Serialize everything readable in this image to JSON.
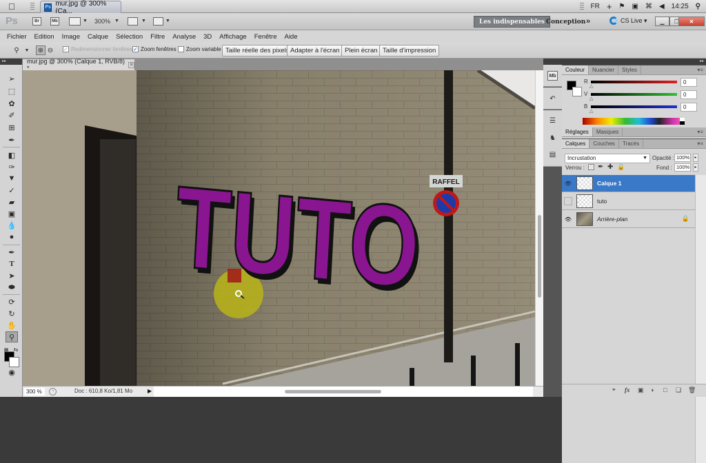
{
  "os_bar": {
    "app_tab": "mur.jpg @ 300% (Ca...",
    "app_badge": "Ps",
    "language": "FR",
    "time": "14:25"
  },
  "app_bar": {
    "logo": "Ps",
    "bridge_label": "Br",
    "minibridge_label": "Mb",
    "zoom_level": "300%",
    "workspaces": [
      "Les indispensables",
      "Conception"
    ],
    "more": "»",
    "cs_live": "CS Live ▾"
  },
  "menu": [
    "Fichier",
    "Edition",
    "Image",
    "Calque",
    "Sélection",
    "Filtre",
    "Analyse",
    "3D",
    "Affichage",
    "Fenêtre",
    "Aide"
  ],
  "options_bar": {
    "resize_windows": {
      "label": "Redimensionner fenêtres",
      "checked": true,
      "enabled": false
    },
    "zoom_windows": {
      "label": "Zoom fenêtres",
      "checked": true
    },
    "scrubby_zoom": {
      "label": "Zoom variable",
      "checked": false
    },
    "buttons": [
      "Taille réelle des pixels",
      "Adapter à l'écran",
      "Plein écran",
      "Taille d'impression"
    ]
  },
  "document": {
    "tab_title": "mur.jpg @ 300% (Calque 1, RVB/8) *",
    "sign_text": "RAFFEL",
    "graffiti_text": "TUTO"
  },
  "status_bar": {
    "zoom": "300 %",
    "doc_info": "Doc : 610,8 Ko/1,81 Mo"
  },
  "color_panel": {
    "tabs": [
      "Couleur",
      "Nuancier",
      "Styles"
    ],
    "active_tab": "Couleur",
    "foreground": "#000000",
    "background": "#ffffff",
    "channels": [
      {
        "label": "R",
        "value": "0",
        "color": "#e02020"
      },
      {
        "label": "V",
        "value": "0",
        "color": "#30c030"
      },
      {
        "label": "B",
        "value": "0",
        "color": "#2030d0"
      }
    ]
  },
  "adjust_panel": {
    "tabs": [
      "Réglages",
      "Masques"
    ],
    "active_tab": "Réglages"
  },
  "layers_panel": {
    "tabs": [
      "Calques",
      "Couches",
      "Tracés"
    ],
    "active_tab": "Calques",
    "blend_mode": "Incrustation",
    "opacity_label": "Opacité :",
    "opacity": "100%",
    "lock_label": "Verrou :",
    "fill_label": "Fond :",
    "fill": "100%",
    "layers": [
      {
        "name": "Calque 1",
        "visible": true,
        "selected": true,
        "locked": false
      },
      {
        "name": "tuto",
        "visible": false,
        "selected": false,
        "locked": false
      },
      {
        "name": "Arrière-plan",
        "visible": true,
        "selected": false,
        "locked": true
      }
    ]
  },
  "colors": {
    "graffiti": "#8a1590",
    "brush_preview": "#b8b418",
    "selection_blue": "#3a78c8"
  }
}
